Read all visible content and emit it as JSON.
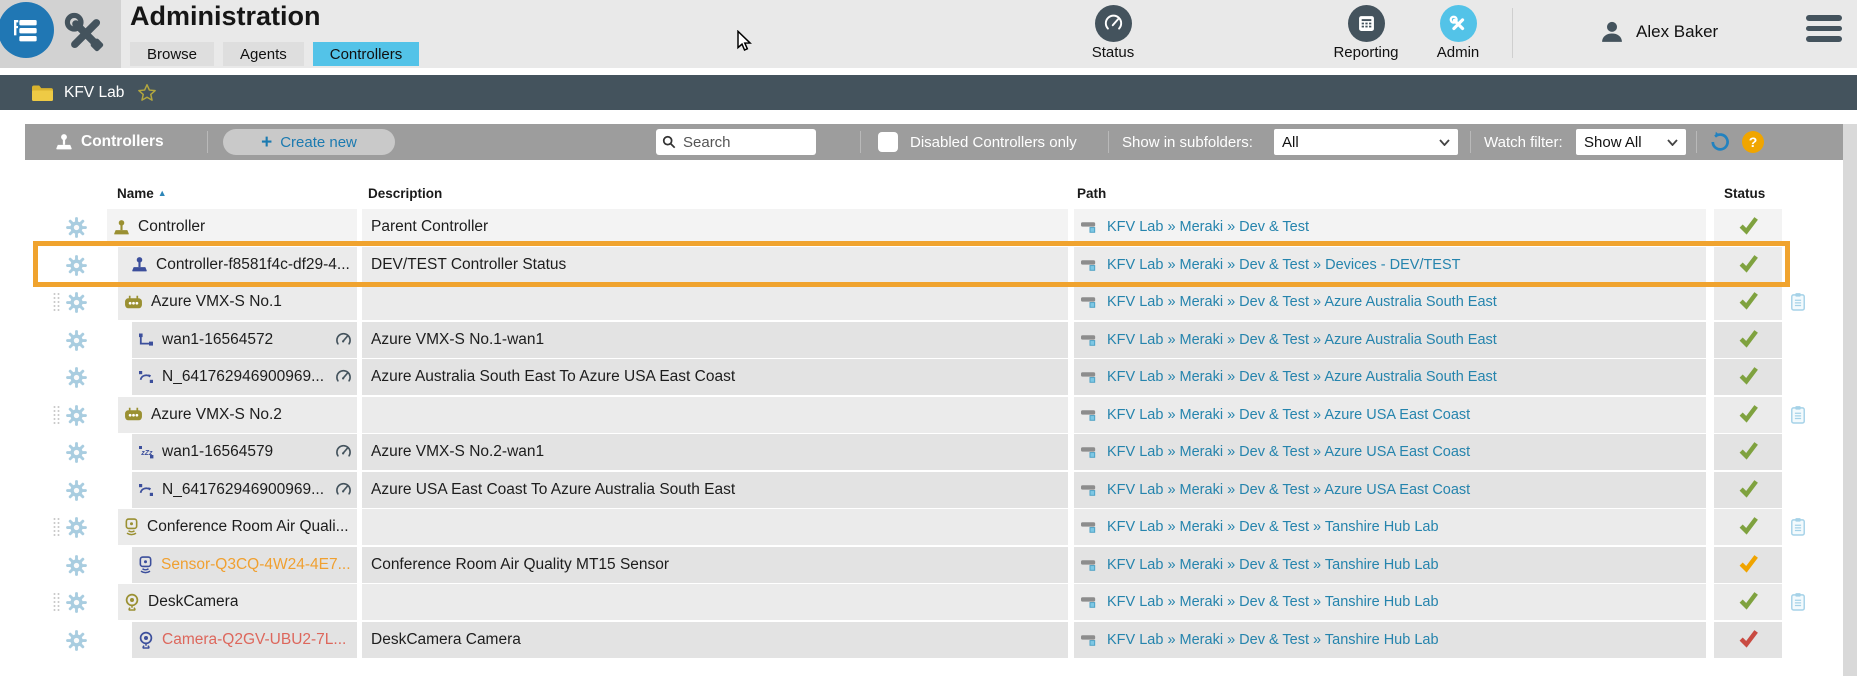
{
  "header": {
    "title": "Administration",
    "tabs": [
      {
        "label": "Browse",
        "active": false
      },
      {
        "label": "Agents",
        "active": false
      },
      {
        "label": "Controllers",
        "active": true
      }
    ],
    "nav": [
      {
        "label": "Status"
      },
      {
        "label": "Reporting"
      },
      {
        "label": "Admin"
      }
    ],
    "user": "Alex Baker"
  },
  "breadcrumb": {
    "folder": "KFV Lab"
  },
  "toolbar": {
    "section_title": "Controllers",
    "create_plus": "+",
    "create_button": "Create new",
    "search_placeholder": "Search",
    "checkbox_label": "Disabled Controllers only",
    "subfolders_label": "Show in subfolders:",
    "subfolders_value": "All",
    "watch_label": "Watch filter:",
    "watch_value": "Show All",
    "help_label": "?"
  },
  "table": {
    "columns": [
      "Name",
      "Description",
      "Path",
      "Status"
    ],
    "rows": [
      {
        "name": "Controller",
        "description": "Parent Controller",
        "path": "KFV Lab » Meraki » Dev & Test",
        "status": "green",
        "icon": "joystick-olive",
        "level": 0
      },
      {
        "name": "Controller-f8581f4c-df29-4...",
        "description": "DEV/TEST Controller Status",
        "path": "KFV Lab » Meraki » Dev & Test » Devices - DEV/TEST",
        "status": "green",
        "icon": "joystick-blue",
        "level": 1,
        "pad": 13,
        "highlighted": true
      },
      {
        "name": "Azure VMX-S No.1",
        "description": "",
        "path": "KFV Lab » Meraki » Dev & Test » Azure Australia South East",
        "status": "green",
        "icon": "device-olive",
        "level": 1,
        "drag": true,
        "clipboard": true
      },
      {
        "name": "wan1-16564572",
        "description": "Azure VMX-S No.1-wan1",
        "path": "KFV Lab » Meraki » Dev & Test » Azure Australia South East",
        "status": "green",
        "icon": "link-up",
        "level": 2,
        "gauge": true
      },
      {
        "name": "N_641762946900969...",
        "description": "Azure Australia South East To Azure USA East Coast",
        "path": "KFV Lab » Meraki » Dev & Test » Azure Australia South East",
        "status": "green",
        "icon": "tunnel",
        "level": 2,
        "gauge": true
      },
      {
        "name": "Azure VMX-S No.2",
        "description": "",
        "path": "KFV Lab » Meraki » Dev & Test » Azure USA East Coast",
        "status": "green",
        "icon": "device-olive",
        "level": 1,
        "drag": true,
        "clipboard": true
      },
      {
        "name": "wan1-16564579",
        "description": "Azure VMX-S No.2-wan1",
        "path": "KFV Lab » Meraki » Dev & Test » Azure USA East Coast",
        "status": "green",
        "icon": "link-sleep",
        "level": 2,
        "gauge": true
      },
      {
        "name": "N_641762946900969...",
        "description": "Azure USA East Coast To Azure Australia South East",
        "path": "KFV Lab » Meraki » Dev & Test » Azure USA East Coast",
        "status": "green",
        "icon": "tunnel",
        "level": 2,
        "gauge": true
      },
      {
        "name": "Conference Room Air Quali...",
        "description": "",
        "path": "KFV Lab » Meraki » Dev & Test » Tanshire Hub Lab",
        "status": "green",
        "icon": "sensor-olive",
        "level": 1,
        "drag": true,
        "clipboard": true
      },
      {
        "name": "Sensor-Q3CQ-4W24-4E7...",
        "description": "Conference Room Air Quality MT15 Sensor",
        "path": "KFV Lab » Meraki » Dev & Test » Tanshire Hub Lab",
        "status": "orange",
        "icon": "sensor-blue",
        "level": 2,
        "name_color": "orange"
      },
      {
        "name": "DeskCamera",
        "description": "",
        "path": "KFV Lab » Meraki » Dev & Test » Tanshire Hub Lab",
        "status": "green",
        "icon": "camera-olive",
        "level": 1,
        "drag": true,
        "clipboard": true
      },
      {
        "name": "Camera-Q2GV-UBU2-7L...",
        "description": "DeskCamera Camera",
        "path": "KFV Lab » Meraki » Dev & Test » Tanshire Hub Lab",
        "status": "red",
        "icon": "camera-blue",
        "level": 2,
        "name_color": "red"
      }
    ]
  },
  "colors": {
    "accent_cyan": "#53c3e8",
    "slate": "#44535d",
    "toolbar_gray": "#9d9d9d",
    "highlight_orange": "#f0a32e",
    "status_green": "#7fa23f",
    "status_orange": "#f0a400",
    "status_red": "#c94b42",
    "path_link_blue": "#2584ad",
    "alert_name_orange": "#f0a030",
    "alert_name_red": "#dd675c"
  }
}
